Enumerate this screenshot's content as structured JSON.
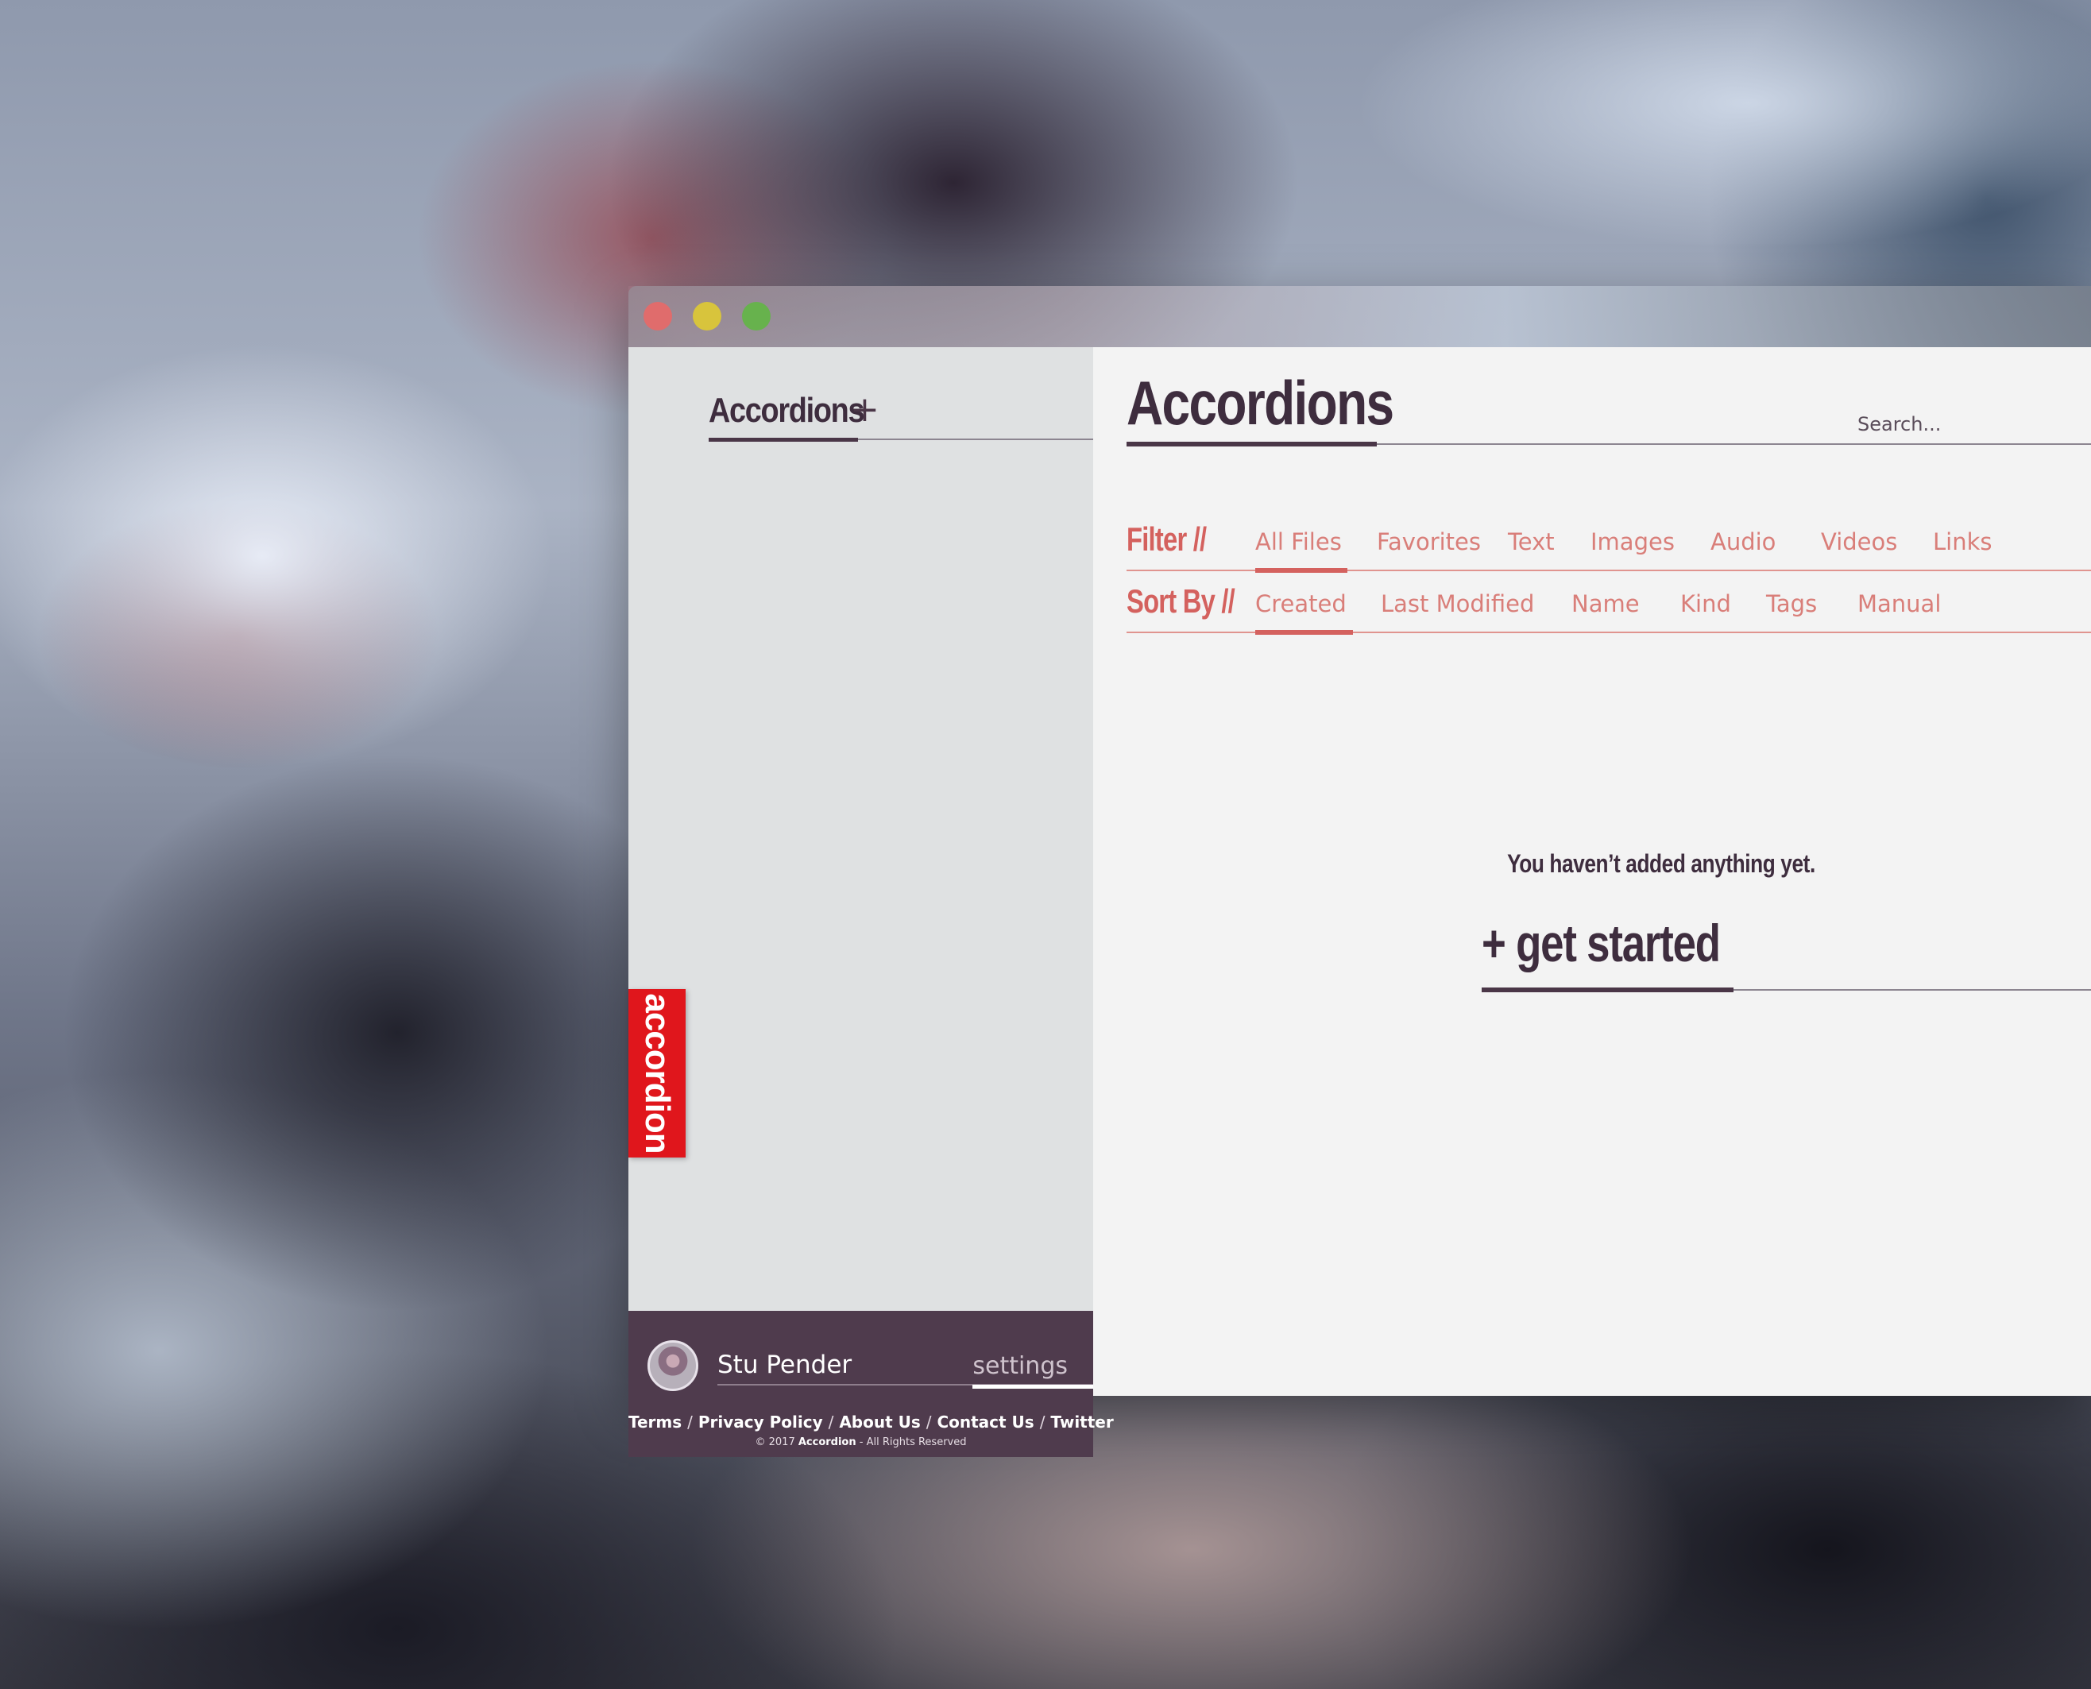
{
  "sidebar": {
    "heading": "Accordions",
    "add_label": "+",
    "brand": "accordion",
    "user": {
      "name": "Stu Pender",
      "settings_label": "settings"
    },
    "footer": {
      "links": [
        "Terms",
        "Privacy Policy",
        "About Us",
        "Contact Us",
        "Twitter"
      ],
      "separator": "/",
      "copyright_prefix": "© 2017",
      "copyright_brand": "Accordion",
      "copyright_suffix": "- All Rights Reserved"
    }
  },
  "main": {
    "title": "Accordions",
    "search": {
      "placeholder": "Search..."
    },
    "filter": {
      "label": "Filter //",
      "options": [
        "All Files",
        "Favorites",
        "Text",
        "Images",
        "Audio",
        "Videos",
        "Links"
      ],
      "active": "All Files"
    },
    "sort": {
      "label": "Sort By //",
      "options": [
        "Created",
        "Last Modified",
        "Name",
        "Kind",
        "Tags",
        "Manual"
      ],
      "active": "Created"
    },
    "empty_state": {
      "message": "You haven’t added anything yet.",
      "cta": "+ get started"
    }
  },
  "colors": {
    "accent": "#d4615e",
    "brand_red": "#e0161c",
    "dark_plum": "#4f3b4d",
    "sidebar_bg": "#dfe1e2",
    "main_bg": "#f3f3f3"
  },
  "icons": {
    "window_controls": [
      "close-icon",
      "minimize-icon",
      "maximize-icon"
    ]
  }
}
